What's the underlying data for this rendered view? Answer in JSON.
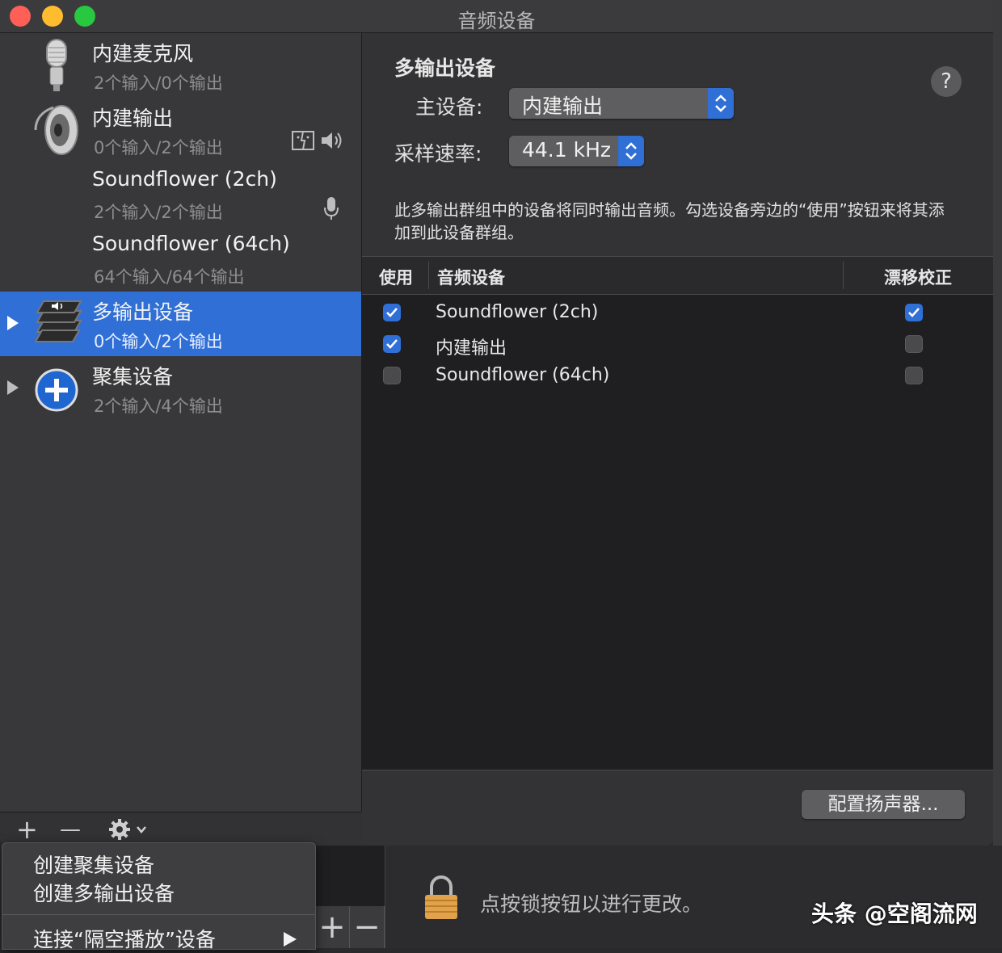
{
  "window": {
    "title": "音频设备"
  },
  "devices": [
    {
      "name": "内建麦克风",
      "io": "2个输入/0个输出",
      "icon": "microphone-icon"
    },
    {
      "name": "内建输出",
      "io": "0个输入/2个输出",
      "icon": "speaker-icon",
      "badges": [
        "finder-icon",
        "volume-icon"
      ]
    },
    {
      "name": "Soundflower (2ch)",
      "io": "2个输入/2个输出",
      "badges": [
        "mic-small-icon"
      ]
    },
    {
      "name": "Soundflower (64ch)",
      "io": "64个输入/64个输出"
    },
    {
      "name": "多输出设备",
      "io": "0个输入/2个输出",
      "icon": "multi-output-icon",
      "selected": true
    },
    {
      "name": "聚集设备",
      "io": "2个输入/4个输出",
      "icon": "aggregate-plus-icon"
    }
  ],
  "toolbar": {
    "add": "+",
    "remove": "—"
  },
  "menu": {
    "items": [
      "创建聚集设备",
      "创建多输出设备"
    ],
    "airplay": "连接“隔空播放”设备"
  },
  "main": {
    "title": "多输出设备",
    "help": "?",
    "master_label": "主设备:",
    "master_value": "内建输出",
    "rate_label": "采样速率:",
    "rate_value": "44.1 kHz",
    "description": "此多输出群组中的设备将同时输出音频。勾选设备旁边的“使用”按钮来将其添加到此设备群组。",
    "columns": [
      "使用",
      "音频设备",
      "漂移校正"
    ],
    "rows": [
      {
        "use": true,
        "device": "Soundflower (2ch)",
        "drift": true
      },
      {
        "use": true,
        "device": "内建输出",
        "drift": false
      },
      {
        "use": false,
        "device": "Soundflower (64ch)",
        "drift": false
      }
    ],
    "config_button": "配置扬声器..."
  },
  "background": {
    "lock_text": "点按锁按钮以进行更改。",
    "watermark": "头条 @空阁流网"
  },
  "colors": {
    "accent": "#2f6fd6",
    "sidebar": "#38383a",
    "table": "#1f1f21"
  }
}
